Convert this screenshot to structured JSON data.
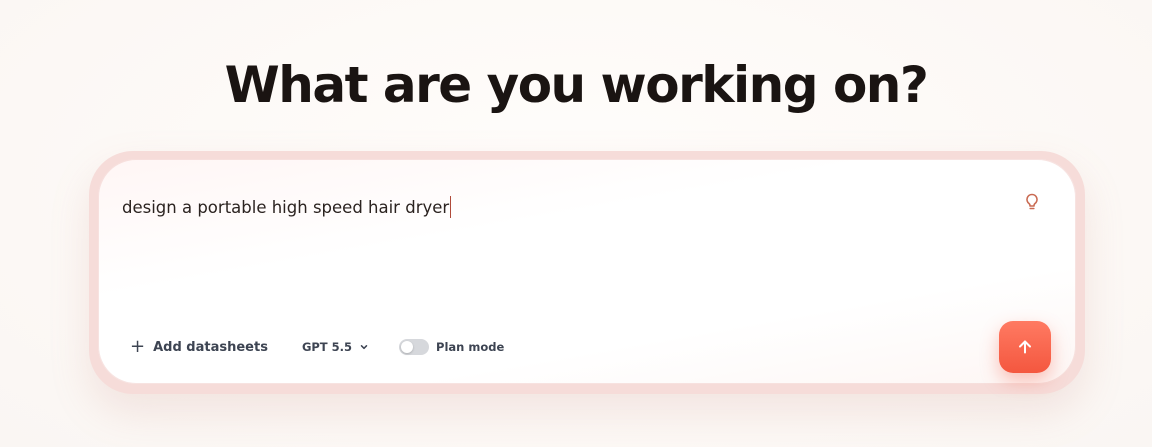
{
  "heading": "What are you working on?",
  "prompt": {
    "value": "design a portable high speed hair dryer"
  },
  "toolbar": {
    "add_datasheets_label": "Add datasheets",
    "model_label": "GPT 5.5",
    "plan_mode_label": "Plan mode",
    "plan_mode_enabled": false
  },
  "icons": {
    "hint": "lightbulb-icon",
    "add": "plus-icon",
    "model_dropdown": "chevron-down-icon",
    "send": "arrow-up-icon"
  },
  "colors": {
    "accent": "#f4573f",
    "hint_icon": "#c96a52",
    "heading": "#1a1412",
    "toolbar_text": "#3d4452"
  }
}
